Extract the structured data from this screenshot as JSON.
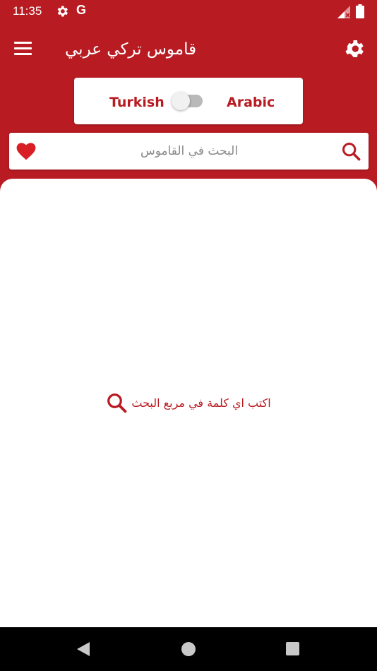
{
  "status_bar": {
    "time": "11:35",
    "g_label": "G",
    "icons": [
      "gear-icon",
      "google-icon",
      "signal-icon",
      "battery-icon"
    ]
  },
  "app_bar": {
    "title": "قاموس تركي عربي",
    "icons": [
      "menu-icon",
      "settings-icon"
    ]
  },
  "language_switch": {
    "left_label": "Turkish",
    "right_label": "Arabic",
    "state": "off"
  },
  "search": {
    "placeholder": "البحث في القاموس",
    "value": "",
    "icons": [
      "heart-icon",
      "search-icon"
    ]
  },
  "empty_state": {
    "hint": "اكتب اي كلمة في مربع البحث",
    "icon": "search-icon"
  },
  "nav_bar": {
    "icons": [
      "back-icon",
      "home-icon",
      "recents-icon"
    ]
  },
  "colors": {
    "primary": "#b81c22",
    "accent_red": "#d81f26",
    "background": "#ffffff",
    "nav_background": "#000000"
  }
}
